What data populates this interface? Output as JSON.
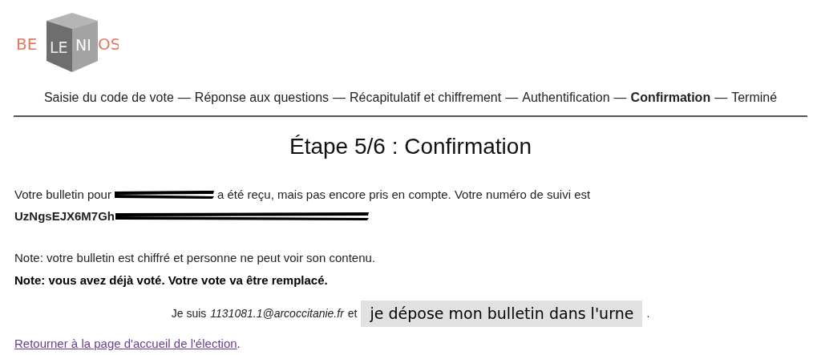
{
  "logo": {
    "left": "BE",
    "face_left": "LE",
    "face_right": "NI",
    "right": "OS"
  },
  "steps": [
    {
      "label": "Saisie du code de vote",
      "selected": false
    },
    {
      "label": "Réponse aux questions",
      "selected": false
    },
    {
      "label": "Récapitulatif et chiffrement",
      "selected": false
    },
    {
      "label": "Authentification",
      "selected": false
    },
    {
      "label": "Confirmation",
      "selected": true
    },
    {
      "label": "Terminé",
      "selected": false
    }
  ],
  "step_separator": "—",
  "heading": "Étape 5/6 : Confirmation",
  "receipt": {
    "before": "Votre bulletin pour",
    "after": "a été reçu, mais pas encore pris en compte. Votre numéro de suivi est",
    "tracking_number": "UzNgsEJX6M7Gh"
  },
  "notes": [
    {
      "text": "Note: votre bulletin est chiffré et personne ne peut voir son contenu.",
      "bold": false
    },
    {
      "text": "Note: vous avez déjà voté. Votre vote va être remplacé.",
      "bold": true
    }
  ],
  "cast": {
    "prefix": "Je suis",
    "user": "1131081.1@arcoccitanie.fr",
    "conjunction": "et",
    "button": "je dépose mon bulletin dans l'urne",
    "suffix": "."
  },
  "back_link": {
    "text": "Retourner à la page d'accueil de l'élection",
    "suffix": "."
  }
}
